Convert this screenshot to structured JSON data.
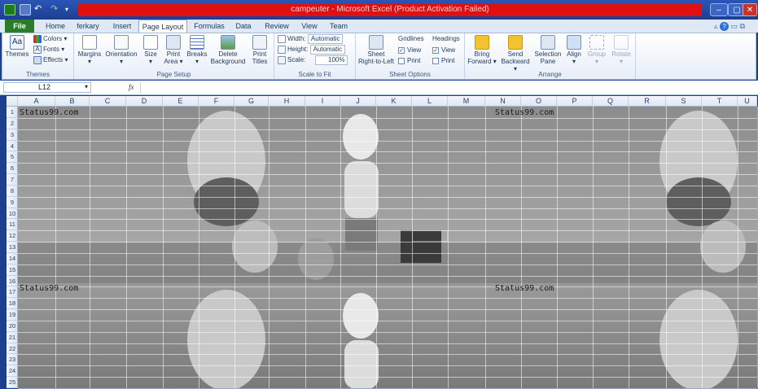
{
  "window": {
    "title": "campeuter  -  Microsoft Excel (Product Activation Failed)"
  },
  "quick_access": [
    "save-icon",
    "undo-icon",
    "redo-icon",
    "customize-icon"
  ],
  "tabs": [
    "File",
    "Home",
    "ferkary",
    "Insert",
    "Page Layout",
    "Formulas",
    "Data",
    "Review",
    "View",
    "Team"
  ],
  "ribbon": {
    "themes": {
      "themes": "Themes",
      "colors": "Colors",
      "fonts": "Fonts",
      "effects": "Effects",
      "label": "Themes"
    },
    "page_setup": {
      "margins": "Margins",
      "orientation": "Orientation",
      "size": "Size",
      "print_area_1": "Print",
      "print_area_2": "Area",
      "breaks": "Breaks",
      "background_1": "Delete",
      "background_2": "Background",
      "titles_1": "Print",
      "titles_2": "Titles",
      "label": "Page Setup"
    },
    "scale": {
      "width_label": "Width:",
      "width_value": "Automatic",
      "height_label": "Height:",
      "height_value": "Automatic",
      "scale_label": "Scale:",
      "scale_value": "100%",
      "label": "Scale to Fit"
    },
    "sheet_options": {
      "rtl_1": "Sheet",
      "rtl_2": "Right-to-Left",
      "gridlines": "Gridlines",
      "headings": "Headings",
      "view": "View",
      "print": "Print",
      "label": "Sheet Options"
    },
    "arrange": {
      "bring_1": "Bring",
      "bring_2": "Forward",
      "send_1": "Send",
      "send_2": "Backward",
      "selection_1": "Selection",
      "selection_2": "Pane",
      "align": "Align",
      "group": "Group",
      "rotate": "Rotate",
      "label": "Arrange"
    }
  },
  "formula_bar": {
    "name_box": "L12",
    "fx": "fx"
  },
  "columns": [
    "A",
    "B",
    "C",
    "D",
    "E",
    "F",
    "G",
    "H",
    "I",
    "J",
    "K",
    "L",
    "M",
    "N",
    "O",
    "P",
    "Q",
    "R",
    "S",
    "T",
    "U"
  ],
  "rows": [
    "1",
    "2",
    "3",
    "4",
    "5",
    "6",
    "7",
    "8",
    "9",
    "10",
    "11",
    "12",
    "13",
    "14",
    "15",
    "16",
    "17",
    "18",
    "19",
    "20",
    "21",
    "22",
    "23",
    "24",
    "25"
  ],
  "watermark": "Status99.com",
  "accent": "#e01010"
}
